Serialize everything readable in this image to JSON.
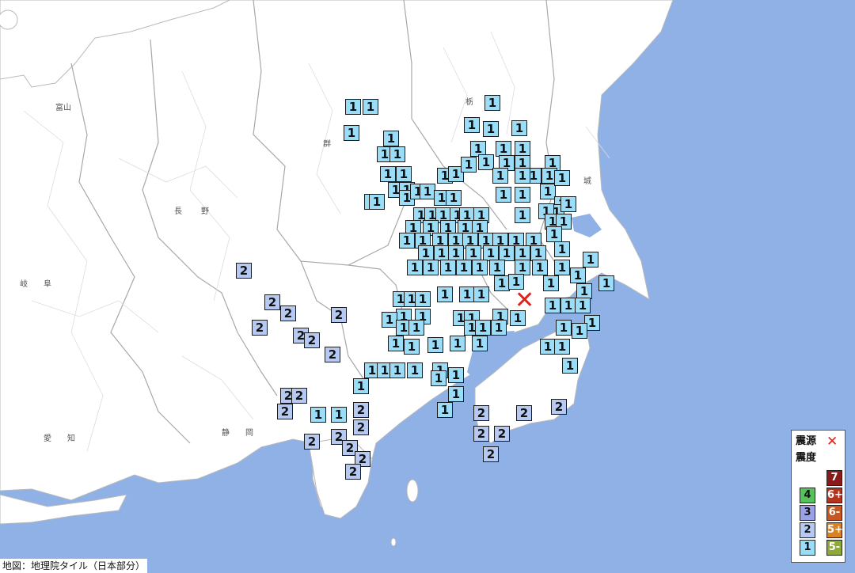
{
  "map_labels": [
    {
      "text": "富山"
    },
    {
      "text": "群"
    },
    {
      "text": "栃"
    },
    {
      "text": "城"
    },
    {
      "text": "長"
    },
    {
      "text": "野"
    },
    {
      "text": "岐"
    },
    {
      "text": "阜"
    },
    {
      "text": "愛"
    },
    {
      "text": "知"
    },
    {
      "text": "静"
    },
    {
      "text": "岡"
    }
  ],
  "legend": {
    "epicenter_label": "震源",
    "epicenter_symbol": "✕",
    "intensity_label": "震度",
    "scale": [
      {
        "label": "7",
        "color": "#8b1a1a",
        "text_color": "#ffffff"
      },
      {
        "label": "6+",
        "color": "#b8331e",
        "text_color": "#ffffff"
      },
      {
        "label": "6-",
        "color": "#c8561f",
        "text_color": "#ffffff"
      },
      {
        "label": "5+",
        "color": "#d98224",
        "text_color": "#ffffff"
      },
      {
        "label": "5-",
        "color": "#8fa83a",
        "text_color": "#ffffff"
      },
      {
        "label": "4",
        "color": "#55c25c",
        "text_color": "#111111"
      },
      {
        "label": "3",
        "color": "#9aa3e6",
        "text_color": "#111111"
      },
      {
        "label": "2",
        "color": "#b5c9f2",
        "text_color": "#111111"
      },
      {
        "label": "1",
        "color": "#9bdcf7",
        "text_color": "#111111"
      }
    ]
  },
  "epicenter": {
    "symbol": "✕",
    "color": "#e0201a"
  },
  "station_markers": [
    "1",
    "1",
    "1",
    "1",
    "1",
    "1",
    "1",
    "1",
    "1",
    "1",
    "1",
    "1",
    "1",
    "1",
    "1",
    "1",
    "1",
    "1",
    "1",
    "1",
    "1",
    "1",
    "1",
    "1",
    "1",
    "1",
    "1",
    "1",
    "1",
    "1",
    "1",
    "1",
    "1",
    "1",
    "1",
    "1",
    "1",
    "1",
    "1",
    "1",
    "1",
    "1",
    "1",
    "1",
    "1",
    "1",
    "1",
    "1",
    "1",
    "1",
    "1",
    "1",
    "1",
    "1",
    "1",
    "1",
    "1",
    "1",
    "1",
    "1",
    "1",
    "1",
    "1",
    "1",
    "1",
    "1",
    "1",
    "1",
    "1",
    "1",
    "1",
    "1",
    "1",
    "1",
    "1",
    "1",
    "1",
    "1",
    "1",
    "1",
    "1",
    "1",
    "1",
    "1",
    "1",
    "1",
    "1",
    "1",
    "1",
    "1",
    "1",
    "1",
    "1",
    "1",
    "1",
    "1",
    "1",
    "1",
    "1",
    "1",
    "1",
    "1",
    "1",
    "1",
    "1",
    "1",
    "1",
    "1",
    "1",
    "1",
    "1",
    "1",
    "1",
    "1",
    "1",
    "1",
    "1",
    "1",
    "1",
    "1",
    "1",
    "1",
    "1",
    "1",
    "1",
    "1",
    "1",
    "1",
    "1",
    "1",
    "1",
    "1",
    "1",
    "1",
    "1",
    "1",
    "2",
    "2",
    "2",
    "2",
    "2",
    "2",
    "2",
    "2",
    "2",
    "2",
    "2",
    "2",
    "2",
    "2",
    "2",
    "2",
    "2",
    "2",
    "2",
    "2",
    "2",
    "2",
    "2",
    "2"
  ],
  "credit": "地図：地理院タイル（日本部分）"
}
